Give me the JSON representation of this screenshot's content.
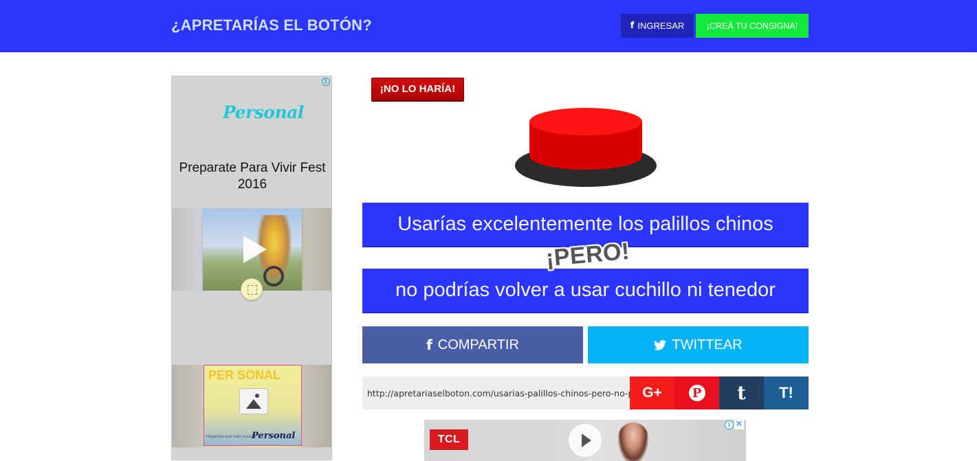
{
  "header": {
    "site_title": "¿APRETARÍAS EL BOTÓN?",
    "login_label": "INGRESAR",
    "create_label": "¡CREÁ TU CONSIGNA!",
    "bg_color": "#2b35fb"
  },
  "left_ad": {
    "brand": "Personal",
    "headline": "Preparate Para Vivir Fest 2016",
    "banner_text": "PER SONAL",
    "banner_fine_print": "Hagamos que todo suceda.",
    "banner_brand": "Personal"
  },
  "main": {
    "verdict_badge": "¡NO LO HARÍA!",
    "statement_1": "Usarías excelentemente los palillos chinos",
    "connector": "¡PERO!",
    "statement_2": "no podrías volver a usar cuchillo ni tenedor",
    "share_facebook": "COMPARTIR",
    "share_twitter": "TWITTEAR",
    "share_url": "http://apretariaselboton.com/usarias-palillos-chinos-pero-no-podrias-volver-a-usar-cuchillo-ni-tenedor",
    "gplus_label": "G+",
    "pinterest_label": "P",
    "tumblr_label": "t",
    "tuenti_label": "T!"
  },
  "bottom_ad": {
    "brand": "TCL"
  },
  "icons": {
    "facebook": "facebook-icon",
    "twitter": "twitter-icon",
    "ad_info": "info-icon",
    "close": "close-icon"
  }
}
